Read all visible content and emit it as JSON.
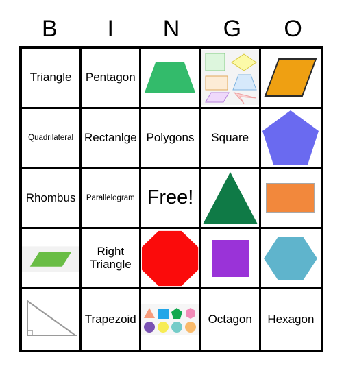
{
  "card": {
    "type": "bingo-card",
    "header": [
      "B",
      "I",
      "N",
      "G",
      "O"
    ],
    "free_space_label": "Free!",
    "colors": {
      "grid_line": "#000000",
      "background": "#ffffff",
      "green_trapezoid": "#33bb6b",
      "orange_parallelogram": "#efa012",
      "blue_pentagon": "#6a6af0",
      "dark_green_triangle": "#0f7a46",
      "orange_rectangle": "#f2883c",
      "red_octagon": "#fb0b0b",
      "purple_square": "#9a33d8",
      "teal_hexagon": "#5fb4cc",
      "green_parallelogram": "#69bd45",
      "right_triangle_outline": "#9a9a9a",
      "band_gray": "#f2f2f2"
    },
    "rows": [
      [
        {
          "name": "cell-b1",
          "kind": "text",
          "label": "Triangle",
          "size": "normal"
        },
        {
          "name": "cell-i1",
          "kind": "text",
          "label": "Pentagon",
          "size": "normal"
        },
        {
          "name": "cell-n1",
          "kind": "shape",
          "shape": "trapezoid-green",
          "alt": "Green trapezoid"
        },
        {
          "name": "cell-g1",
          "kind": "shape",
          "shape": "polygon-collection-pastel",
          "alt": "Collection of pastel quadrilaterals: green square, yellow rhombus, orange rectangle, blue trapezoid, purple parallelogram, pink concave quadrilateral"
        },
        {
          "name": "cell-o1",
          "kind": "shape",
          "shape": "parallelogram-orange",
          "alt": "Orange parallelogram"
        }
      ],
      [
        {
          "name": "cell-b2",
          "kind": "text",
          "label": "Quadrilateral",
          "size": "small"
        },
        {
          "name": "cell-i2",
          "kind": "text",
          "label": "Rectanlge",
          "size": "normal"
        },
        {
          "name": "cell-n2",
          "kind": "text",
          "label": "Polygons",
          "size": "normal"
        },
        {
          "name": "cell-g2",
          "kind": "text",
          "label": "Square",
          "size": "normal"
        },
        {
          "name": "cell-o2",
          "kind": "shape",
          "shape": "pentagon-blue",
          "alt": "Blue pentagon"
        }
      ],
      [
        {
          "name": "cell-b3",
          "kind": "text",
          "label": "Rhombus",
          "size": "normal"
        },
        {
          "name": "cell-i3",
          "kind": "text",
          "label": "Parallelogram",
          "size": "small"
        },
        {
          "name": "cell-n3",
          "kind": "text",
          "label": "Free!",
          "size": "free"
        },
        {
          "name": "cell-g3",
          "kind": "shape",
          "shape": "triangle-darkgreen",
          "alt": "Dark green triangle"
        },
        {
          "name": "cell-o3",
          "kind": "shape",
          "shape": "rectangle-orange",
          "alt": "Orange rectangle"
        }
      ],
      [
        {
          "name": "cell-b4",
          "kind": "shape",
          "shape": "parallelogram-green-band",
          "alt": "Green parallelogram on gray band"
        },
        {
          "name": "cell-i4",
          "kind": "text",
          "label": "Right Triangle",
          "size": "normal"
        },
        {
          "name": "cell-n4",
          "kind": "shape",
          "shape": "octagon-red",
          "alt": "Red octagon"
        },
        {
          "name": "cell-g4",
          "kind": "shape",
          "shape": "square-purple",
          "alt": "Purple square"
        },
        {
          "name": "cell-o4",
          "kind": "shape",
          "shape": "hexagon-teal",
          "alt": "Teal hexagon"
        }
      ],
      [
        {
          "name": "cell-b5",
          "kind": "shape",
          "shape": "right-triangle-outline",
          "alt": "Right triangle outline with right angle mark"
        },
        {
          "name": "cell-i5",
          "kind": "text",
          "label": "Trapezoid",
          "size": "normal"
        },
        {
          "name": "cell-n5",
          "kind": "shape",
          "shape": "small-shape-grid",
          "alt": "Eight small colored shapes in two rows"
        },
        {
          "name": "cell-g5",
          "kind": "text",
          "label": "Octagon",
          "size": "normal"
        },
        {
          "name": "cell-o5",
          "kind": "text",
          "label": "Hexagon",
          "size": "normal"
        }
      ]
    ]
  }
}
